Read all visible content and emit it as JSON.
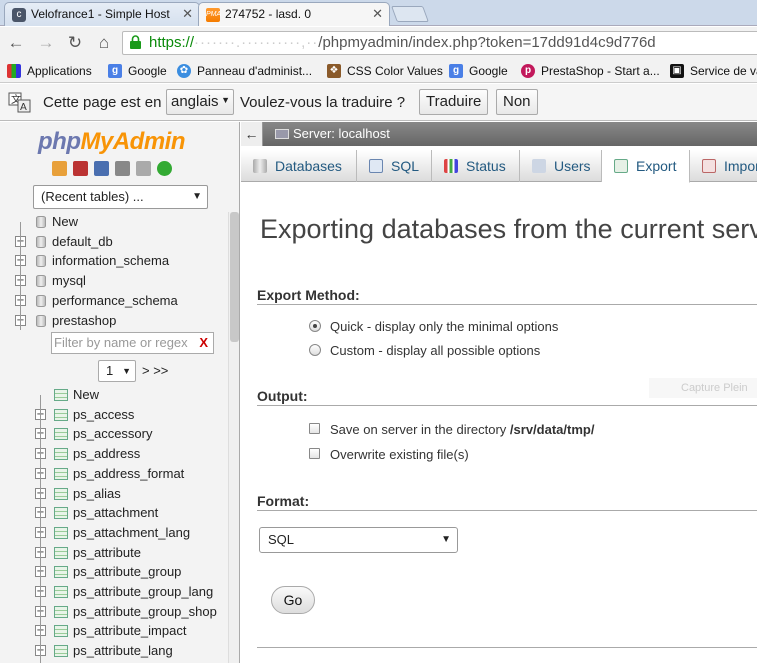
{
  "browser": {
    "tabs": [
      {
        "title": "Velofrance1 - Simple Host",
        "icon": "cpanel-icon"
      },
      {
        "title": "274752 - lasd. 0",
        "icon": "phpmyadmin-icon"
      }
    ],
    "url": {
      "scheme": "https://",
      "masked": "·······.··········,··",
      "rest": "/phpmyadmin/index.php?token=17dd91d4c9d776d"
    },
    "bookmarks": [
      {
        "label": "Applications",
        "icon": "apps-grid-icon",
        "color": "#c33"
      },
      {
        "label": "Google",
        "icon": "google-icon",
        "color": "#4a7fe6"
      },
      {
        "label": "Panneau d'administ...",
        "icon": "panel-icon",
        "color": "#3a8de0"
      },
      {
        "label": "CSS Color Values",
        "icon": "css-icon",
        "color": "#8a5a2a"
      },
      {
        "label": "Google",
        "icon": "google-icon",
        "color": "#4a7fe6"
      },
      {
        "label": "PrestaShop - Start a...",
        "icon": "prestashop-icon",
        "color": "#c2185b"
      },
      {
        "label": "Service de va",
        "icon": "service-icon",
        "color": "#111"
      }
    ]
  },
  "translate": {
    "message": "Cette page est en",
    "language": "anglais",
    "question": "Voulez-vous la traduire ?",
    "translate_label": "Traduire",
    "no_label": "Non"
  },
  "pma": {
    "logo_php": "php",
    "logo_myadmin": "MyAdmin",
    "recent_tables": "(Recent tables) ...",
    "tree": {
      "new_db": "New",
      "databases": [
        "default_db",
        "information_schema",
        "mysql",
        "performance_schema",
        "prestashop"
      ],
      "filter_placeholder": "Filter by name or regex",
      "filter_clear": "X",
      "page": "1",
      "page_next": "> >>",
      "new_table": "New",
      "tables": [
        "ps_access",
        "ps_accessory",
        "ps_address",
        "ps_address_format",
        "ps_alias",
        "ps_attachment",
        "ps_attachment_lang",
        "ps_attribute",
        "ps_attribute_group",
        "ps_attribute_group_lang",
        "ps_attribute_group_shop",
        "ps_attribute_impact",
        "ps_attribute_lang"
      ]
    },
    "server_breadcrumb": "Server: localhost",
    "menu": [
      {
        "label": "Databases",
        "icon": "databases-icon"
      },
      {
        "label": "SQL",
        "icon": "sql-icon"
      },
      {
        "label": "Status",
        "icon": "status-icon"
      },
      {
        "label": "Users",
        "icon": "users-icon"
      },
      {
        "label": "Export",
        "icon": "export-icon",
        "active": true
      },
      {
        "label": "Import",
        "icon": "import-icon"
      }
    ],
    "page_title": "Exporting databases from the current server",
    "export_method": {
      "label": "Export Method:",
      "options": [
        "Quick - display only the minimal options",
        "Custom - display all possible options"
      ],
      "selected": 0
    },
    "output": {
      "label": "Output:",
      "save_prefix": "Save on server in the directory ",
      "save_dir": "/srv/data/tmp/",
      "overwrite": "Overwrite existing file(s)"
    },
    "format": {
      "label": "Format:",
      "value": "SQL"
    },
    "go_label": "Go",
    "watermark": "Capture Plein"
  }
}
